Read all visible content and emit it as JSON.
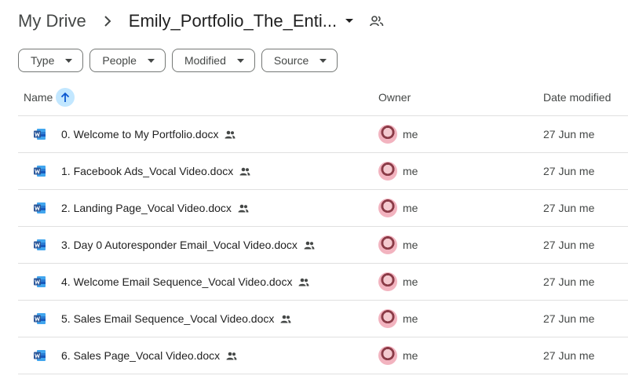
{
  "breadcrumb": {
    "root": "My Drive",
    "current": "Emily_Portfolio_The_Enti..."
  },
  "filters": [
    {
      "label": "Type"
    },
    {
      "label": "People"
    },
    {
      "label": "Modified"
    },
    {
      "label": "Source"
    }
  ],
  "columns": {
    "name": "Name",
    "owner": "Owner",
    "date": "Date modified"
  },
  "files": [
    {
      "name": "0. Welcome to My Portfolio.docx",
      "owner": "me",
      "date": "27 Jun me"
    },
    {
      "name": "1. Facebook Ads_Vocal Video.docx",
      "owner": "me",
      "date": "27 Jun me"
    },
    {
      "name": "2. Landing Page_Vocal Video.docx",
      "owner": "me",
      "date": "27 Jun me"
    },
    {
      "name": "3. Day 0 Autoresponder Email_Vocal Video.docx",
      "owner": "me",
      "date": "27 Jun me"
    },
    {
      "name": "4. Welcome Email Sequence_Vocal Video.docx",
      "owner": "me",
      "date": "27 Jun me"
    },
    {
      "name": "5. Sales Email Sequence_Vocal Video.docx",
      "owner": "me",
      "date": "27 Jun me"
    },
    {
      "name": "6. Sales Page_Vocal Video.docx",
      "owner": "me",
      "date": "27 Jun me"
    }
  ],
  "colors": {
    "word_blue": "#2b579a",
    "sort_bg": "#c2e7ff",
    "sort_arrow": "#0b57d0"
  }
}
